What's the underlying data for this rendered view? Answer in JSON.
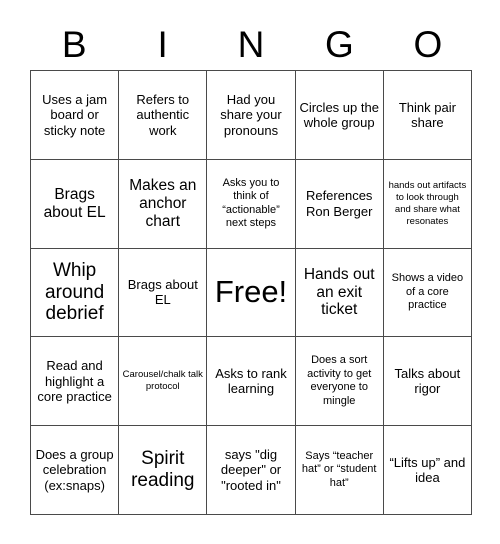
{
  "card": {
    "header_letters": [
      "B",
      "I",
      "N",
      "G",
      "O"
    ],
    "rows": [
      [
        {
          "text": "Uses a jam board or sticky note",
          "size": "md"
        },
        {
          "text": "Refers to authentic work",
          "size": "md"
        },
        {
          "text": "Had you share your pronouns",
          "size": "md"
        },
        {
          "text": "Circles up the whole group",
          "size": "md"
        },
        {
          "text": "Think pair share",
          "size": "md"
        }
      ],
      [
        {
          "text": "Brags about EL",
          "size": "lg"
        },
        {
          "text": "Makes an anchor chart",
          "size": "lg"
        },
        {
          "text": "Asks you to think of “actionable” next steps",
          "size": "sm"
        },
        {
          "text": "References Ron Berger",
          "size": "md"
        },
        {
          "text": "hands out artifacts to look through and share what resonates",
          "size": "xs"
        }
      ],
      [
        {
          "text": "Whip around debrief",
          "size": "xl"
        },
        {
          "text": "Brags about EL",
          "size": "md"
        },
        {
          "text": "Free!",
          "size": "xxl"
        },
        {
          "text": "Hands out an exit ticket",
          "size": "lg"
        },
        {
          "text": "Shows a video of a core practice",
          "size": "sm"
        }
      ],
      [
        {
          "text": "Read and highlight a core practice",
          "size": "md"
        },
        {
          "text": "Carousel/chalk talk protocol",
          "size": "xs"
        },
        {
          "text": "Asks to rank learning",
          "size": "md"
        },
        {
          "text": "Does a sort activity to get everyone to mingle",
          "size": "sm"
        },
        {
          "text": "Talks about rigor",
          "size": "md"
        }
      ],
      [
        {
          "text": "Does a group celebration (ex:snaps)",
          "size": "md"
        },
        {
          "text": "Spirit reading",
          "size": "xl"
        },
        {
          "text": "says \"dig deeper\" or \"rooted in\"",
          "size": "md"
        },
        {
          "text": "Says “teacher hat” or “student hat”",
          "size": "sm"
        },
        {
          "text": "“Lifts up” and idea",
          "size": "md"
        }
      ]
    ]
  },
  "colors": {
    "background": "#ffffff",
    "text": "#000000",
    "grid_line": "#4a4a4a"
  }
}
